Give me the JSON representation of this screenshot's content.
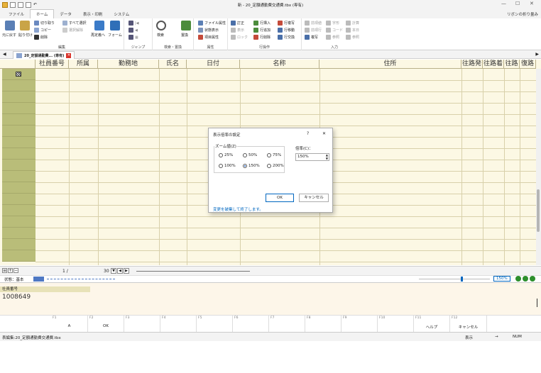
{
  "window": {
    "title": "新 - 20_定額通勤費交通費.tbx (専有)",
    "minimize": "—",
    "maximize": "☐",
    "close": "✕"
  },
  "menu": {
    "tabs": [
      "ファイル",
      "ホーム",
      "データ",
      "表示・印刷",
      "システム"
    ],
    "active": "ホーム",
    "ribbon_toggle": "リボンの折り畳み"
  },
  "ribbon": {
    "groups": {
      "edit": "編集",
      "jump": "ジャンプ",
      "search": "検索・置換",
      "attr": "属性",
      "rowop": "行操作",
      "input": "入力"
    },
    "edit": {
      "undo": "元に戻す",
      "paste": "貼り付け",
      "cut": "切り取り",
      "copy": "コピー",
      "delete": "削除",
      "select_all": "すべて選択",
      "deselect": "選択解除",
      "recalc": "再定義へ",
      "form": "フォーム"
    },
    "search": {
      "search": "検索",
      "replace": "置換"
    },
    "attr": {
      "file_attr": "ファイル属性",
      "state_view": "状態表示",
      "item_attr": "項目属性"
    },
    "rowop": {
      "correct": "訂正",
      "show": "表示",
      "lock": "ロック",
      "row_insert": "行挿入",
      "row_add": "行追加",
      "row_delete": "行削除",
      "row_copy": "行複写",
      "row_move": "行移動",
      "row_swap": "行交換"
    },
    "input": {
      "prev": "前項値",
      "prev_row": "前項行",
      "row_copy": "複写",
      "char": "字形",
      "code": "コード",
      "jump_to": "参照",
      "calc": "計算",
      "today": "本日",
      "memo": "記号",
      "ref": "参照"
    }
  },
  "doc_tab": {
    "label": "20_定額通勤費... (専有)"
  },
  "grid": {
    "columns": [
      "社員番号",
      "所属",
      "勤務地",
      "氏名",
      "日付",
      "名称",
      "住所",
      "往路発",
      "往路着",
      "往路",
      "復路"
    ]
  },
  "nav": {
    "page": "1 /",
    "total": "30"
  },
  "status": {
    "label": "状態：基本"
  },
  "field_panel": {
    "label": "社員番号",
    "value": "1008649"
  },
  "fkeys": [
    {
      "n": "F1",
      "l": "A"
    },
    {
      "n": "F2",
      "l": "OK"
    },
    {
      "n": "F3",
      "l": ""
    },
    {
      "n": "F4",
      "l": ""
    },
    {
      "n": "F5",
      "l": ""
    },
    {
      "n": "F6",
      "l": ""
    },
    {
      "n": "F7",
      "l": ""
    },
    {
      "n": "F8",
      "l": ""
    },
    {
      "n": "F9",
      "l": ""
    },
    {
      "n": "F10",
      "l": ""
    },
    {
      "n": "F11",
      "l": "ヘルプ"
    },
    {
      "n": "F12",
      "l": "キャンセル"
    }
  ],
  "app_status": {
    "file": "表編集:20_定額通勤費交通費.tbx",
    "view": "表示",
    "arrow": "→",
    "num": "NUM"
  },
  "zoom": {
    "value": "150%",
    "level": 0.6
  },
  "dialog": {
    "title": "表示倍率の設定",
    "help": "?",
    "close": "✕",
    "group_label": "ズーム値(Z)",
    "options": [
      "25%",
      "50%",
      "75%",
      "100%",
      "150%",
      "200%"
    ],
    "selected": "150%",
    "ratio_label": "倍率(C)：",
    "ratio_value": "150%",
    "ok": "OK",
    "cancel": "キャンセル",
    "link": "変更を破棄して終了します。"
  },
  "colors": {
    "grid_bg": "#fcf8e4",
    "row_header": "#b9bd79",
    "accent": "#0067c0",
    "field_panel_header": "#e8e2b8"
  }
}
